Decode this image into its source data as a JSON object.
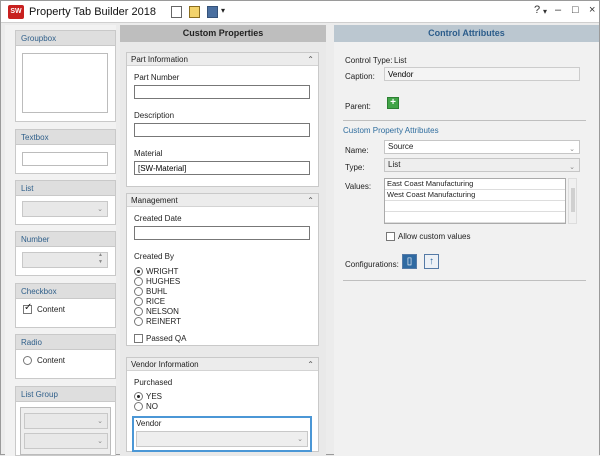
{
  "window": {
    "app_icon": "SW",
    "title": "Property Tab Builder  2018",
    "help": "?",
    "help_dropdown": "▾",
    "minimize": "–",
    "maximize": "□",
    "close": "×"
  },
  "toolbar": {
    "new_icon": "new-document-icon",
    "open_icon": "open-folder-icon",
    "save_icon": "save-icon",
    "dropdown": "▾"
  },
  "palette": {
    "groupbox": "Groupbox",
    "textbox": "Textbox",
    "list": "List",
    "number": "Number",
    "checkbox": "Checkbox",
    "checkbox_content": "Content",
    "radio": "Radio",
    "radio_content": "Content",
    "list_group": "List Group"
  },
  "custom_properties": {
    "title": "Custom Properties",
    "part_info": {
      "title": "Part Information",
      "part_number_label": "Part Number",
      "part_number_value": "",
      "description_label": "Description",
      "description_value": "",
      "material_label": "Material",
      "material_value": "[SW-Material]"
    },
    "management": {
      "title": "Management",
      "created_date_label": "Created Date",
      "created_date_value": "",
      "created_by_label": "Created By",
      "options": [
        "WRIGHT",
        "HUGHES",
        "BUHL",
        "RICE",
        "NELSON",
        "REINERT"
      ],
      "passed_qa": "Passed QA"
    },
    "vendor_info": {
      "title": "Vendor Information",
      "purchased_label": "Purchased",
      "yes": "YES",
      "no": "NO",
      "vendor_label": "Vendor"
    }
  },
  "control_attributes": {
    "title": "Control Attributes",
    "control_type_label": "Control Type:",
    "control_type_value": "List",
    "caption_label": "Caption:",
    "caption_value": "Vendor",
    "parent_label": "Parent:",
    "custom_property_attributes": "Custom Property Attributes",
    "name_label": "Name:",
    "name_value": "Source",
    "type_label": "Type:",
    "type_value": "List",
    "values_label": "Values:",
    "values": [
      "East Coast Manufacturing",
      "West Coast Manufacturing",
      "",
      ""
    ],
    "allow_custom_values": "Allow custom values",
    "configurations_label": "Configurations:"
  },
  "icons": {
    "combo_arrow": "⌄",
    "collapse": "⌃",
    "stepper_up": "▲",
    "stepper_down": "▼",
    "add_parent": "+",
    "configuration_single": "▯",
    "configuration_all": "↑"
  }
}
